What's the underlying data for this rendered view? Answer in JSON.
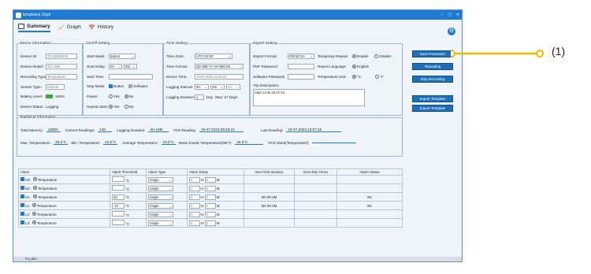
{
  "window": {
    "title": "temptrace Cityd"
  },
  "tabs": [
    {
      "label": "Summary"
    },
    {
      "label": "Graph"
    },
    {
      "label": "History"
    }
  ],
  "device": {
    "legend": "Device Information",
    "id_label": "Device ID:",
    "id_val": "TC125800075",
    "model_label": "Device Model:",
    "model_val": "TC1-880",
    "rtype_label": "Recording Type:",
    "rtype_val": "Temperature",
    "stype_label": "Sensor Type:",
    "stype_val": "Internal",
    "battery_label": "Battery Level:",
    "battery_val": "100%",
    "status_label": "Device Status:",
    "status_val": "Logging"
  },
  "onoff": {
    "legend": "On/Off Setting",
    "start_mode_label": "Start Mode:",
    "start_mode": "Button",
    "start_delay_label": "Start Delay:",
    "delay_h": "0H",
    "delay_m": "0M",
    "start_time_label": "Start Time:",
    "stop_mode_label": "Stop Mode:",
    "stop_button": "Button",
    "stop_software": "Software",
    "pause_label": "Pause:",
    "yes": "Yes",
    "no": "No",
    "repeat_label": "Repeat Start:"
  },
  "time": {
    "legend": "Time Setting",
    "zone_label": "Time Zone:",
    "zone": "UTC+02:00",
    "format_label": "Time Format:",
    "format": "DD-MM-YY HH:MM:SS",
    "dtime_label": "Device Time:",
    "dtime": "19-07-2023 11:59:22",
    "interval_label": "Logging Interval:",
    "int_h": "0H",
    "int_m": "2M",
    "int_s": "0S",
    "duration_label": "Logging Duration:",
    "duration": "1",
    "day": "Day",
    "max": "Max: 27 Days"
  },
  "report": {
    "legend": "Report Setting",
    "format_label": "Report Format:",
    "format": "PDF&CSV",
    "repeat_label": "Temperary Repeat:",
    "enable": "Enable",
    "disable": "Disable",
    "pdfpw_label": "PDF Password:",
    "lang_label": "Report Language:",
    "lang": "English",
    "swpw_label": "Software Password:",
    "unit_label": "Temperature Unit:",
    "c": "°C",
    "f": "°F",
    "trip_label": "Trip Description:",
    "trip": "Start 13:45 15.07.23"
  },
  "buttons": {
    "save": "Save Parameter",
    "reload": "Reloading",
    "stop": "Stop Recording",
    "import": "Import Template",
    "export": "Export Template"
  },
  "stats": {
    "legend": "Statistical Information",
    "total_label": "Total Memory:",
    "total": "16000",
    "cur_label": "Current Readings:",
    "cur": "128",
    "dur_label": "Logging Duration:",
    "dur": "4H 16M",
    "first_label": "First Reading:",
    "first": "19-07-2023 09:45:15",
    "last_label": "Last Reading:",
    "last": "19-07-2023 13:57:15",
    "max_label": "Max. Temperature:",
    "max": "26.5°C",
    "min_label": "Min. Temperature:",
    "min": "24.0°C",
    "avg_label": "Average Temperature:",
    "avg": "24.9°C",
    "mkt_label": "Mean Kinetic Temperature(MKT):",
    "mkt": "25.0°C",
    "fa_label": "First Alarm(Temperature):"
  },
  "alarm": {
    "headers": [
      "Alarm",
      "Alarm Threshold",
      "Alarm Type",
      "Alarm Delay",
      "Over-limit duration",
      "Over-limit Times",
      "Alarm Status"
    ],
    "rows": [
      {
        "name": "H3:",
        "sensor": "Temperature",
        "thr": "",
        "type": "Single",
        "d": "0",
        "dur": "",
        "times": "",
        "status": ""
      },
      {
        "name": "H2:",
        "sensor": "Temperature",
        "thr": "",
        "type": "Single",
        "d": "0",
        "dur": "",
        "times": "",
        "status": ""
      },
      {
        "name": "H1:",
        "sensor": "Temperature",
        "thr": "30",
        "type": "Single",
        "d": "0",
        "dur": "0D 0H 0M",
        "times": "",
        "status": "OK"
      },
      {
        "name": "L1:",
        "sensor": "Temperature",
        "thr": "-10",
        "type": "Single",
        "d": "0",
        "dur": "0D 0H 0M",
        "times": "",
        "status": "OK"
      },
      {
        "name": "L2:",
        "sensor": "Temperature",
        "thr": "",
        "type": "Single",
        "d": "0",
        "dur": "",
        "times": "",
        "status": ""
      },
      {
        "name": "L3:",
        "sensor": "Temperature",
        "thr": "",
        "type": "Single",
        "d": "0",
        "dur": "",
        "times": "",
        "status": ""
      }
    ],
    "unit": "°C",
    "h": "H",
    "m": "M"
  },
  "status": {
    "text": "TC1-880"
  },
  "callout": {
    "label": "(1)",
    "color": "#f2b700"
  }
}
